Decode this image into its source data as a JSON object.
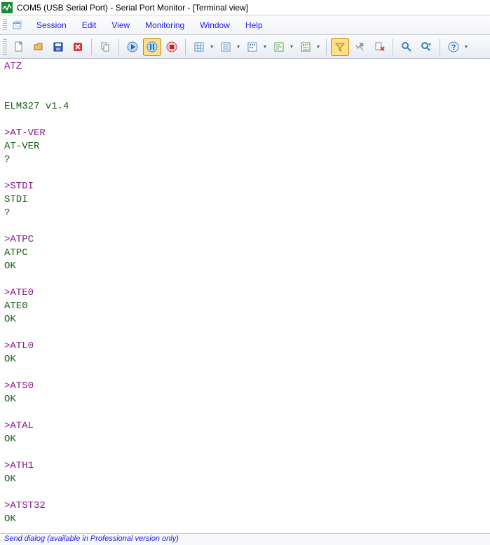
{
  "title": "COM5 (USB Serial Port) - Serial Port Monitor - [Terminal view]",
  "menubar": {
    "items": [
      "Session",
      "Edit",
      "View",
      "Monitoring",
      "Window",
      "Help"
    ]
  },
  "toolbar": {
    "icons": [
      "new-session-icon",
      "open-session-icon",
      "save-session-icon",
      "close-session-icon",
      "sep",
      "copy-icon",
      "sep",
      "play-icon",
      "pause-icon",
      "stop-icon",
      "sep",
      "table-view-icon",
      "dd",
      "line-view-icon",
      "dd",
      "dump-view-icon",
      "dd",
      "terminal-view-icon",
      "dd",
      "modem-view-icon",
      "dd",
      "sep",
      "filter-icon",
      "settings-icon",
      "clear-icon",
      "sep",
      "find-icon",
      "find-next-icon",
      "sep",
      "help-icon",
      "dd"
    ]
  },
  "terminal": {
    "lines": [
      {
        "cls": "t-in",
        "text": "ATZ"
      },
      {
        "cls": "",
        "text": ""
      },
      {
        "cls": "",
        "text": ""
      },
      {
        "cls": "t-out",
        "text": "ELM327 v1.4"
      },
      {
        "cls": "",
        "text": ""
      },
      {
        "cls": "t-in",
        "text": ">AT-VER"
      },
      {
        "cls": "t-out",
        "text": "AT-VER"
      },
      {
        "cls": "t-out",
        "text": "?"
      },
      {
        "cls": "",
        "text": ""
      },
      {
        "cls": "t-in",
        "text": ">STDI"
      },
      {
        "cls": "t-out",
        "text": "STDI"
      },
      {
        "cls": "t-out",
        "text": "?"
      },
      {
        "cls": "",
        "text": ""
      },
      {
        "cls": "t-in",
        "text": ">ATPC"
      },
      {
        "cls": "t-out",
        "text": "ATPC"
      },
      {
        "cls": "t-out",
        "text": "OK"
      },
      {
        "cls": "",
        "text": ""
      },
      {
        "cls": "t-in",
        "text": ">ATE0"
      },
      {
        "cls": "t-out",
        "text": "ATE0"
      },
      {
        "cls": "t-out",
        "text": "OK"
      },
      {
        "cls": "",
        "text": ""
      },
      {
        "cls": "t-in",
        "text": ">ATL0"
      },
      {
        "cls": "t-out",
        "text": "OK"
      },
      {
        "cls": "",
        "text": ""
      },
      {
        "cls": "t-in",
        "text": ">ATS0"
      },
      {
        "cls": "t-out",
        "text": "OK"
      },
      {
        "cls": "",
        "text": ""
      },
      {
        "cls": "t-in",
        "text": ">ATAL"
      },
      {
        "cls": "t-out",
        "text": "OK"
      },
      {
        "cls": "",
        "text": ""
      },
      {
        "cls": "t-in",
        "text": ">ATH1"
      },
      {
        "cls": "t-out",
        "text": "OK"
      },
      {
        "cls": "",
        "text": ""
      },
      {
        "cls": "t-in",
        "text": ">ATST32"
      },
      {
        "cls": "t-out",
        "text": "OK"
      }
    ]
  },
  "statusbar": "Send dialog (available in Professional version only)"
}
